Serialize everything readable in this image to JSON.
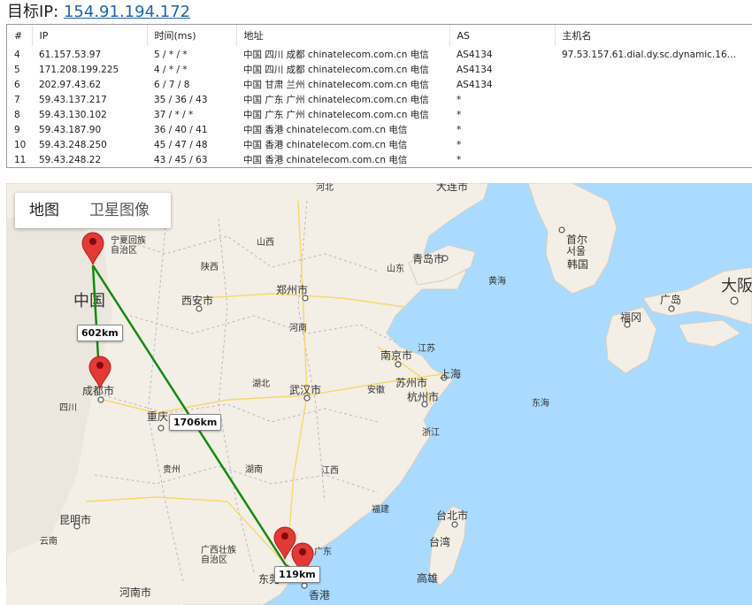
{
  "header": {
    "label": "目标IP:",
    "ip": "154.91.194.172"
  },
  "table": {
    "columns": [
      "#",
      "IP",
      "时间(ms)",
      "地址",
      "AS",
      "主机名"
    ],
    "rows": [
      [
        "4",
        "61.157.53.97",
        "5 / * / *",
        "中国 四川 成都 chinatelecom.com.cn 电信",
        "AS4134",
        "97.53.157.61.dial.dy.sc.dynamic.16…"
      ],
      [
        "5",
        "171.208.199.225",
        "4 / * / *",
        "中国 四川 成都 chinatelecom.com.cn 电信",
        "AS4134",
        ""
      ],
      [
        "6",
        "202.97.43.62",
        "6 / 7 / 8",
        "中国 甘肃 兰州 chinatelecom.com.cn 电信",
        "AS4134",
        ""
      ],
      [
        "7",
        "59.43.137.217",
        "35 / 36 / 43",
        "中国 广东 广州 chinatelecom.com.cn 电信",
        "*",
        ""
      ],
      [
        "8",
        "59.43.130.102",
        "37 / * / *",
        "中国 广东 广州 chinatelecom.com.cn 电信",
        "*",
        ""
      ],
      [
        "9",
        "59.43.187.90",
        "36 / 40 / 41",
        "中国 香港 chinatelecom.com.cn 电信",
        "*",
        ""
      ],
      [
        "10",
        "59.43.248.250",
        "45 / 47 / 48",
        "中国 香港 chinatelecom.com.cn 电信",
        "*",
        ""
      ],
      [
        "11",
        "59.43.248.22",
        "43 / 45 / 63",
        "中国 香港 chinatelecom.com.cn 电信",
        "*",
        ""
      ]
    ]
  },
  "map": {
    "map_type_buttons": [
      "地图",
      "卫星图像"
    ],
    "distances": [
      "602km",
      "1706km",
      "119km"
    ],
    "cities": [
      "大连市",
      "青岛市",
      "首尔\n서울",
      "韩国",
      "郑州市",
      "西安市",
      "中国",
      "南京市",
      "上海",
      "苏州市",
      "杭州市",
      "武汉市",
      "成都市",
      "重庆",
      "昆明市",
      "台北市",
      "台湾",
      "高雄",
      "东莞",
      "香港",
      "福冈",
      "广岛",
      "大阪",
      "宁夏回族\n自治区",
      "广西壮族\n自治区",
      "河南市"
    ],
    "regions": [
      "河北",
      "山西",
      "陕西",
      "山东",
      "河南",
      "江苏",
      "安徽",
      "湖北",
      "浙江",
      "四川",
      "贵州",
      "湖南",
      "江西",
      "福建",
      "云南",
      "广东",
      "黄海",
      "东海"
    ],
    "colors": {
      "land": "#f3efe6",
      "water": "#aadaff",
      "route": "#138a13",
      "marker": "#e53935"
    }
  }
}
